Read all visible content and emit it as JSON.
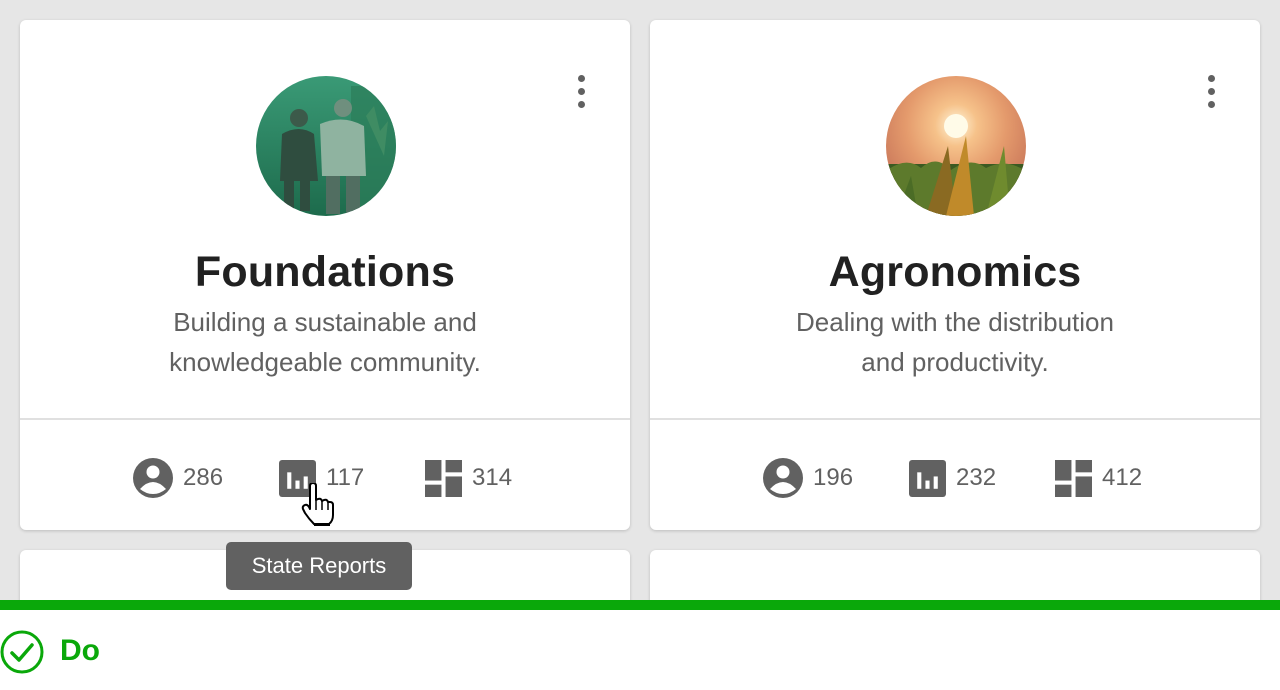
{
  "colors": {
    "background": "#e6e6e6",
    "card": "#ffffff",
    "icon": "#616161",
    "do_green": "#0aa80a"
  },
  "cards": [
    {
      "title": "Foundations",
      "description_line1": "Building a sustainable and",
      "description_line2": "knowledgeable community.",
      "image_icon": "people-in-field-photo",
      "stats": {
        "users": "286",
        "reports": "117",
        "dashboards": "314"
      }
    },
    {
      "title": "Agronomics",
      "description_line1": "Dealing with the distribution",
      "description_line2": "and productivity.",
      "image_icon": "sunset-cornfield-photo",
      "stats": {
        "users": "196",
        "reports": "232",
        "dashboards": "412"
      }
    }
  ],
  "tooltip": {
    "text": "State Reports"
  },
  "guideline": {
    "label": "Do",
    "icon": "check-circle-icon"
  }
}
